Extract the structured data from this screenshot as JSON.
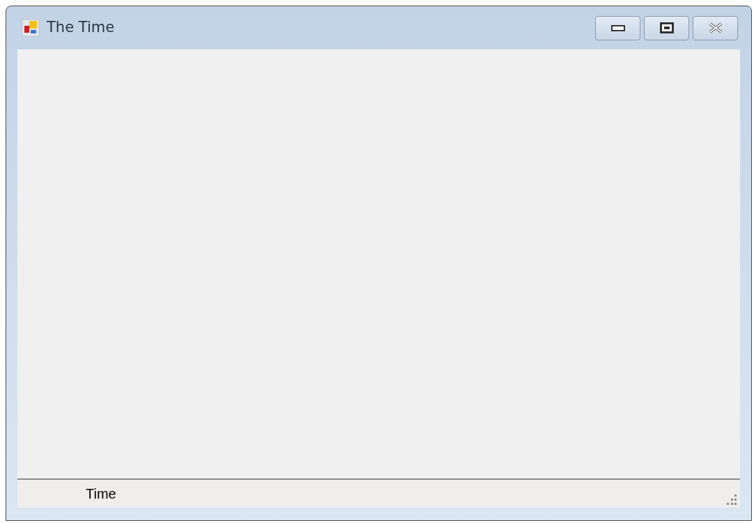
{
  "window": {
    "title": "The Time"
  },
  "status_bar": {
    "label": "Time"
  }
}
